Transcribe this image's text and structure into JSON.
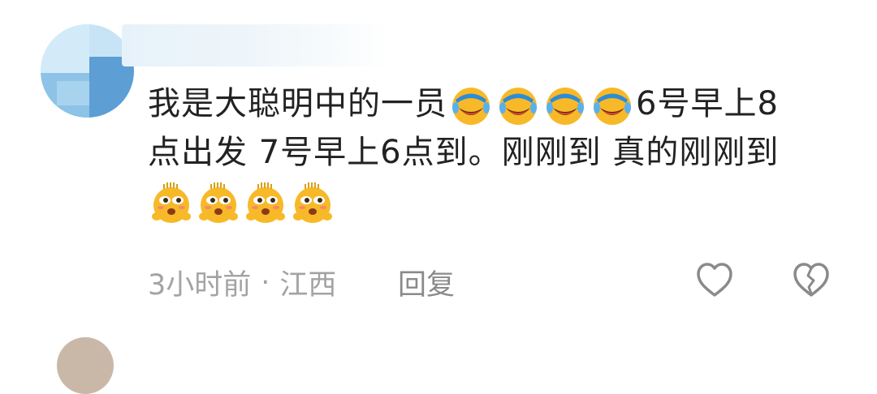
{
  "comment": {
    "line1_text": "我是大聪明中的一员",
    "line1_tail": "6号早上8",
    "line2_text": "点出发 7号早上6点到。刚刚到 真的刚刚到",
    "crying_emoji": "crying-laughing-face",
    "hot_emoji": "sweating-hot-face",
    "crying_count": 4,
    "hot_count": 4
  },
  "meta": {
    "time": "3小时前",
    "separator": "·",
    "location": "江西",
    "reply_label": "回复"
  },
  "actions": {
    "like_icon": "heart-outline-icon",
    "dislike_icon": "broken-heart-icon"
  },
  "colors": {
    "text": "#222222",
    "meta": "#a3a3a3",
    "icon": "#8a8a8a",
    "emoji_face": "#f7b928"
  }
}
